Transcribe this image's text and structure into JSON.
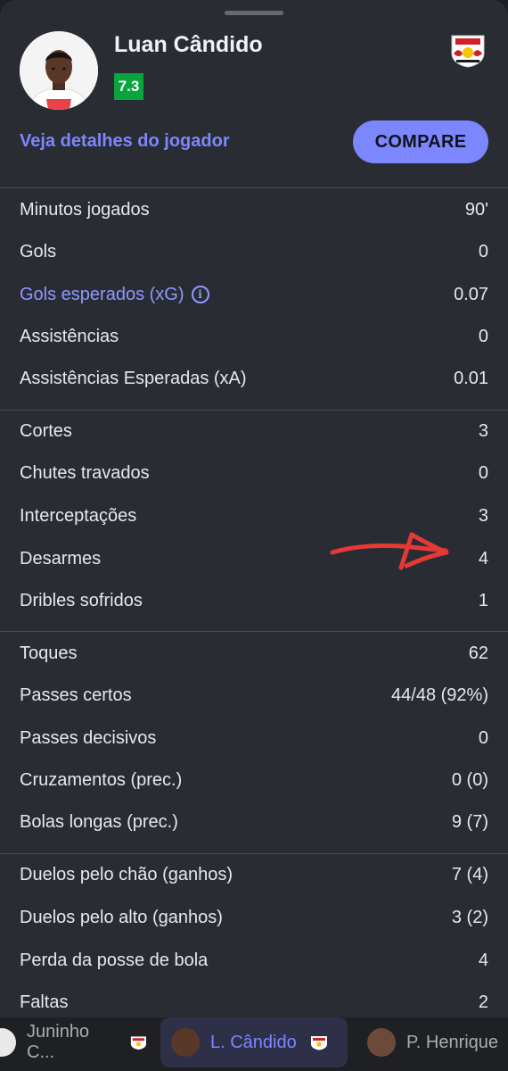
{
  "player": {
    "name": "Luan Cândido",
    "rating": "7.3"
  },
  "header": {
    "details_link": "Veja detalhes do jogador",
    "compare_label": "COMPARE"
  },
  "stats": [
    {
      "label": "Minutos jogados",
      "value": "90'"
    },
    {
      "label": "Gols",
      "value": "0"
    },
    {
      "label": "Gols esperados (xG)",
      "value": "0.07",
      "info": true
    },
    {
      "label": "Assistências",
      "value": "0"
    },
    {
      "label": "Assistências Esperadas (xA)",
      "value": "0.01"
    },
    {
      "label": "Cortes",
      "value": "3"
    },
    {
      "label": "Chutes travados",
      "value": "0"
    },
    {
      "label": "Interceptações",
      "value": "3"
    },
    {
      "label": "Desarmes",
      "value": "4"
    },
    {
      "label": "Dribles sofridos",
      "value": "1"
    },
    {
      "label": "Toques",
      "value": "62"
    },
    {
      "label": "Passes certos",
      "value": "44/48 (92%)"
    },
    {
      "label": "Passes decisivos",
      "value": "0"
    },
    {
      "label": "Cruzamentos (prec.)",
      "value": "0 (0)"
    },
    {
      "label": "Bolas longas (prec.)",
      "value": "9 (7)"
    },
    {
      "label": "Duelos pelo chão (ganhos)",
      "value": "7 (4)"
    },
    {
      "label": "Duelos pelo alto (ganhos)",
      "value": "3 (2)"
    },
    {
      "label": "Perda da posse de bola",
      "value": "4"
    },
    {
      "label": "Faltas",
      "value": "2"
    }
  ],
  "player_tabs": [
    {
      "label": "Juninho C...",
      "active": false
    },
    {
      "label": "L. Cândido",
      "active": true
    },
    {
      "label": "P. Henrique",
      "active": false
    }
  ],
  "colors": {
    "accent": "#7c86ff",
    "rating_bg": "#08a43c",
    "annotation_arrow": "#e53935",
    "sheet_bg": "#2a2c33"
  },
  "icons": [
    "info-icon",
    "red-bull-bragantino-logo",
    "player-photo",
    "hand-drawn-arrow"
  ]
}
